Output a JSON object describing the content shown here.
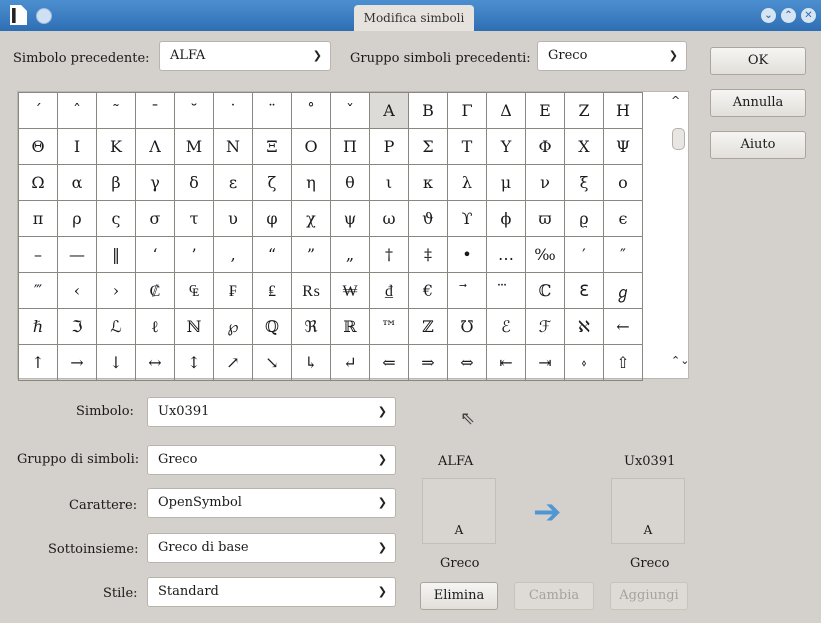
{
  "window": {
    "title": "Modifica simboli"
  },
  "top": {
    "prev_symbol_label": "Simbolo precedente:",
    "prev_symbol_value": "ALFA",
    "prev_group_label": "Gruppo simboli precedenti:",
    "prev_group_value": "Greco"
  },
  "buttons": {
    "ok": "OK",
    "cancel": "Annulla",
    "help": "Aiuto"
  },
  "grid": {
    "rows": [
      [
        "´",
        "ˆ",
        "˜",
        "¯",
        "˘",
        "˙",
        "¨",
        "˚",
        "ˇ",
        "Α",
        "Β",
        "Γ",
        "Δ",
        "Ε",
        "Ζ",
        "Η"
      ],
      [
        "Θ",
        "Ι",
        "Κ",
        "Λ",
        "Μ",
        "Ν",
        "Ξ",
        "Ο",
        "Π",
        "Ρ",
        "Σ",
        "Τ",
        "Υ",
        "Φ",
        "Χ",
        "Ψ"
      ],
      [
        "Ω",
        "α",
        "β",
        "γ",
        "δ",
        "ε",
        "ζ",
        "η",
        "θ",
        "ι",
        "κ",
        "λ",
        "μ",
        "ν",
        "ξ",
        "ο"
      ],
      [
        "π",
        "ρ",
        "ς",
        "σ",
        "τ",
        "υ",
        "φ",
        "χ",
        "ψ",
        "ω",
        "ϑ",
        "ϒ",
        "ϕ",
        "ϖ",
        "ϱ",
        "ϵ"
      ],
      [
        "–",
        "—",
        "‖",
        "‘",
        "’",
        "‚",
        "“",
        "”",
        "„",
        "†",
        "‡",
        "•",
        "…",
        "‰",
        "′",
        "″"
      ],
      [
        "‴",
        "‹",
        "›",
        "₡",
        "₠",
        "₣",
        "₤",
        "₨",
        "₩",
        "₫",
        "€",
        "⃗",
        "⃛",
        "ℂ",
        "ℇ",
        "ℊ"
      ],
      [
        "ℏ",
        "ℑ",
        "ℒ",
        "ℓ",
        "ℕ",
        "℘",
        "ℚ",
        "ℜ",
        "ℝ",
        "™",
        "ℤ",
        "℧",
        "ℰ",
        "ℱ",
        "ℵ",
        "←"
      ],
      [
        "↑",
        "→",
        "↓",
        "↔",
        "↕",
        "↗",
        "↘",
        "↳",
        "↵",
        "⇐",
        "⇒",
        "⇔",
        "⇤",
        "⇥",
        "⬫",
        "⇧"
      ]
    ],
    "selected": "Α"
  },
  "bottom": {
    "symbol_label": "Simbolo:",
    "symbol_value": "Ux0391",
    "group_label": "Gruppo di simboli:",
    "group_value": "Greco",
    "font_label": "Carattere:",
    "font_value": "OpenSymbol",
    "subset_label": "Sottoinsieme:",
    "subset_value": "Greco di base",
    "style_label": "Stile:",
    "style_value": "Standard"
  },
  "preview": {
    "old_name": "ALFA",
    "old_char": "A",
    "old_group": "Greco",
    "new_name": "Ux0391",
    "new_char": "A",
    "new_group": "Greco"
  },
  "actions": {
    "delete": "Elimina",
    "modify": "Cambia",
    "add": "Aggiungi"
  }
}
